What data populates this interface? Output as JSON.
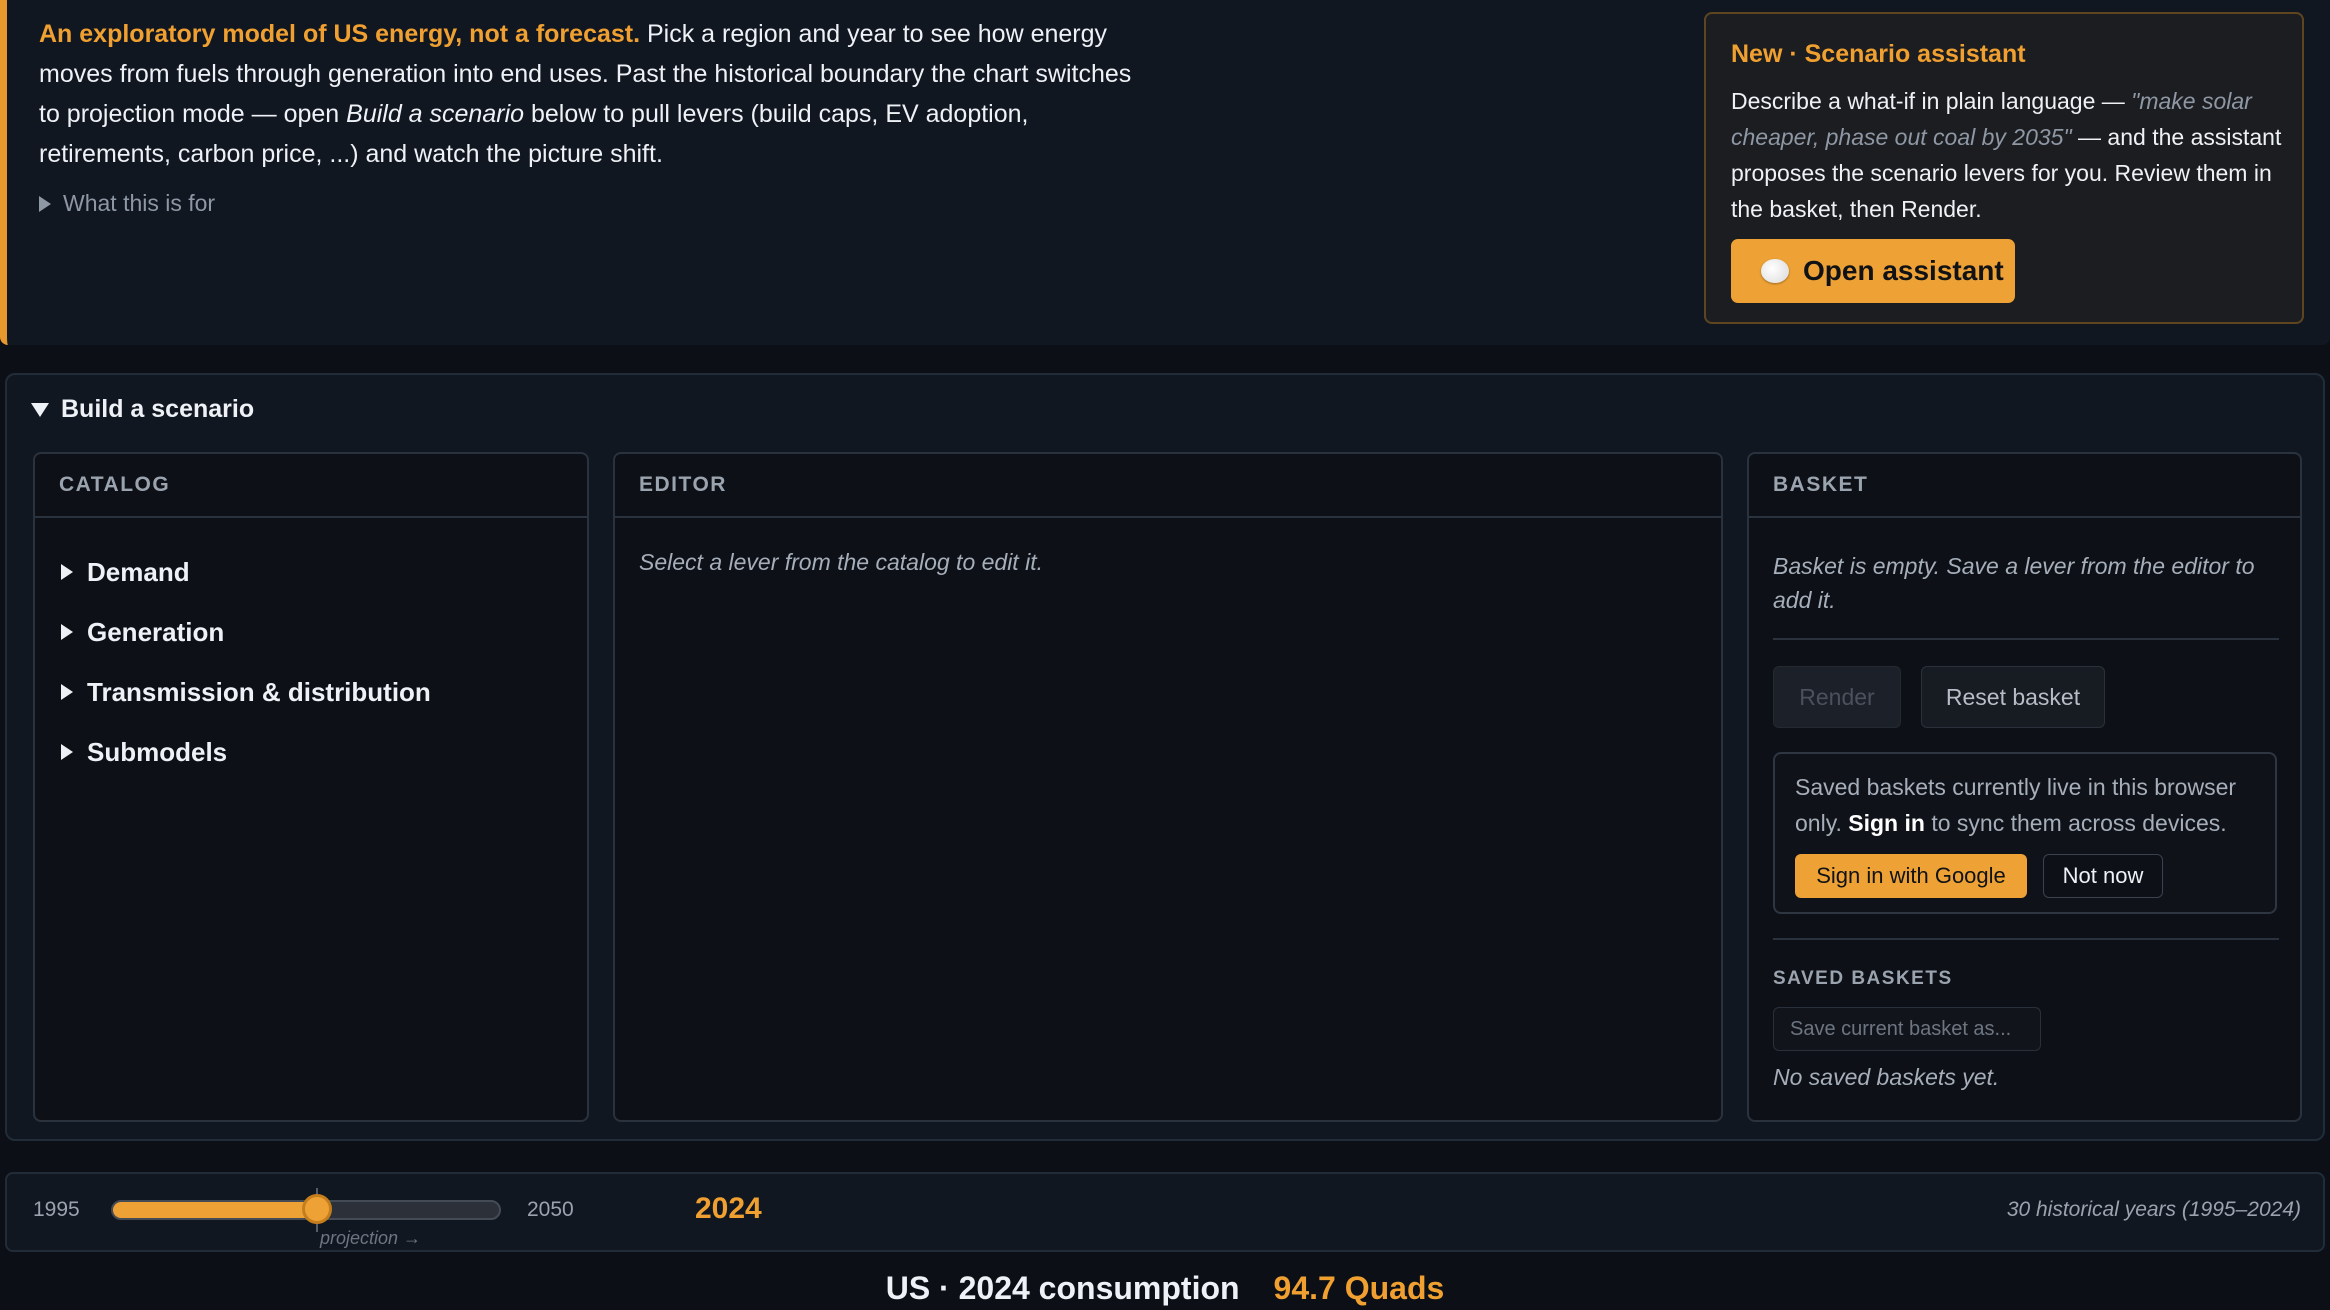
{
  "intro": {
    "lead": "An exploratory model of US energy, not a forecast.",
    "text_1": " Pick a region and year to see how energy moves from fuels through generation into end uses. Past the historical boundary the chart switches to projection mode — open ",
    "emphasis": "Build a scenario",
    "text_2": " below to pull levers (build caps, EV adoption, retirements, carbon price, ...) and watch the picture shift.",
    "what_for": "What this is for"
  },
  "assistant": {
    "title": "New · Scenario assistant",
    "desc_1": "Describe a what-if in plain language — ",
    "quote": "\"make solar cheaper, phase out coal by 2035\"",
    "desc_2": " — and the assistant proposes the scenario levers for you. Review them in the basket, then Render.",
    "button": "Open assistant"
  },
  "build": {
    "summary": "Build a scenario",
    "catalog": {
      "title": "CATALOG",
      "items": [
        "Demand",
        "Generation",
        "Transmission & distribution",
        "Submodels"
      ]
    },
    "editor": {
      "title": "EDITOR",
      "hint": "Select a lever from the catalog to edit it."
    },
    "basket": {
      "title": "BASKET",
      "empty": "Basket is empty. Save a lever from the editor to add it.",
      "render": "Render",
      "reset": "Reset basket",
      "signin_1": "Saved baskets currently live in this browser only. ",
      "signin_bold": "Sign in",
      "signin_2": " to sync them across devices.",
      "google": "Sign in with Google",
      "not_now": "Not now",
      "saved_title": "SAVED BASKETS",
      "save_placeholder": "Save current basket as...",
      "no_saved": "No saved baskets yet."
    }
  },
  "timeline": {
    "min": "1995",
    "max": "2050",
    "min_year": 1995,
    "max_year": 2050,
    "year": "2024",
    "year_value": 2024,
    "boundary_year": 2024,
    "projection_label": "projection →",
    "historical": "30 historical years (1995–2024)"
  },
  "consumption": {
    "label": "US · 2024 consumption",
    "value": "94.7 Quads"
  },
  "colors": {
    "accent": "#eea236",
    "accent_text": "#f0a030",
    "background": "#0c1016",
    "panel": "#111721"
  }
}
